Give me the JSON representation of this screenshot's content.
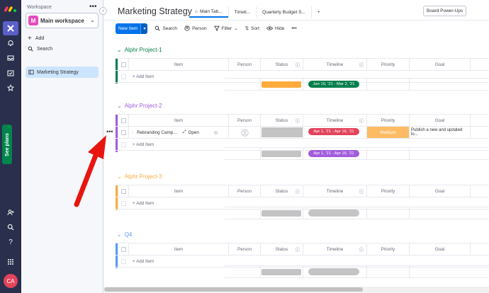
{
  "colors": {
    "rail_bg": "#292f4c",
    "accent": "#0073ea",
    "group1": "#037f4c",
    "group2": "#a25ddc",
    "group3": "#fdab3d",
    "group4": "#579bfc",
    "status_orange": "#fdab3d",
    "timeline_red": "#e2445c",
    "priority_medium": "#fdbc64",
    "arrow_red": "#e8150f"
  },
  "rail": {
    "icons": [
      "monday-logo-icon",
      "workspace-icon",
      "bell-icon",
      "inbox-icon",
      "my-work-icon",
      "star-icon",
      "invite-icon",
      "search-icon",
      "help-icon",
      "apps-grid-icon"
    ],
    "see_plans_label": "See plans",
    "avatar_initials": "CA"
  },
  "workspace_panel": {
    "label": "Workspace",
    "workspace_name": "Main workspace",
    "workspace_initial": "M",
    "add_label": "Add",
    "search_label": "Search",
    "board_label": "Marketing Strategy"
  },
  "header": {
    "title": "Marketing Strategy",
    "tabs": [
      {
        "label": "Main Tab..."
      },
      {
        "label": "Timeli..."
      },
      {
        "label": "Quarterly Budget S..."
      }
    ],
    "add_tab": "+",
    "powerups_label": "Board Power-Ups"
  },
  "toolbar": {
    "new_item_label": "New Item",
    "search_label": "Search",
    "person_label": "Person",
    "filter_label": "Filter",
    "sort_label": "Sort",
    "hide_label": "Hide",
    "more_label": "•••"
  },
  "columns": {
    "item": "Item",
    "person": "Person",
    "status": "Status",
    "timeline": "Timeline",
    "priority": "Priority",
    "goal": "Goal"
  },
  "add_item_label": "+ Add Item",
  "groups": [
    {
      "title": "Alphr Project-1",
      "summary_timeline": "Jan 10, '21 - Mar 2, '21"
    },
    {
      "title": "Alphr Project-2",
      "summary_timeline": "Apr 1, '21 - Apr 16, '21",
      "item": {
        "name": "Rebranding Camp...",
        "open_label": "Open",
        "timeline": "Apr 1, '21 - Apr 16, '21",
        "priority": "Medium",
        "goal": "Publish a new and updated lo..."
      }
    },
    {
      "title": "Alphr Project-3"
    },
    {
      "title": "Q4"
    }
  ]
}
